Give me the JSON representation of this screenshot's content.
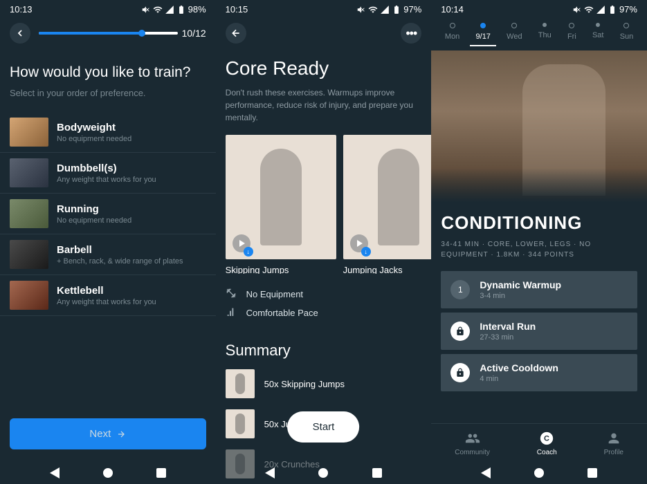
{
  "screen1": {
    "time": "10:13",
    "battery": "98%",
    "progress": "10/12",
    "question": "How would you like to train?",
    "subtitle": "Select in your order of preference.",
    "options": [
      {
        "name": "Bodyweight",
        "desc": "No equipment needed"
      },
      {
        "name": "Dumbbell(s)",
        "desc": "Any weight that works for you"
      },
      {
        "name": "Running",
        "desc": "No equipment needed"
      },
      {
        "name": "Barbell",
        "desc": "+ Bench, rack, & wide range of plates"
      },
      {
        "name": "Kettlebell",
        "desc": "Any weight that works for you"
      }
    ],
    "next": "Next"
  },
  "screen2": {
    "time": "10:15",
    "battery": "97%",
    "title": "Core Ready",
    "description": "Don't rush these exercises. Warmups improve performance, reduce risk of injury, and prepare you mentally.",
    "exercises": [
      {
        "label": "Skipping Jumps"
      },
      {
        "label": "Jumping Jacks"
      }
    ],
    "meta": {
      "equipment": "No Equipment",
      "pace": "Comfortable Pace"
    },
    "summary_title": "Summary",
    "summary": [
      {
        "text": "50x Skipping Jumps"
      },
      {
        "text": "50x Ju"
      },
      {
        "text": "20x Crunches"
      }
    ],
    "start": "Start"
  },
  "screen3": {
    "time": "10:14",
    "battery": "97%",
    "days": [
      {
        "label": "Mon",
        "active": false,
        "filled": false
      },
      {
        "label": "9/17",
        "active": true,
        "filled": true
      },
      {
        "label": "Wed",
        "active": false,
        "filled": false
      },
      {
        "label": "Thu",
        "active": false,
        "filled": false
      },
      {
        "label": "Fri",
        "active": false,
        "filled": false
      },
      {
        "label": "Sat",
        "active": false,
        "filled": false
      },
      {
        "label": "Sun",
        "active": false,
        "filled": false
      }
    ],
    "workout_title": "CONDITIONING",
    "workout_meta": "34-41 MIN · CORE, LOWER, LEGS · NO EQUIPMENT · 1.8KM · 344 POINTS",
    "segments": [
      {
        "badge": "1",
        "locked": false,
        "name": "Dynamic Warmup",
        "duration": "3-4 min"
      },
      {
        "badge": "lock",
        "locked": true,
        "name": "Interval Run",
        "duration": "27-33 min"
      },
      {
        "badge": "lock",
        "locked": true,
        "name": "Active Cooldown",
        "duration": "4 min"
      }
    ],
    "tabs": [
      {
        "label": "Community",
        "active": false
      },
      {
        "label": "Coach",
        "active": true
      },
      {
        "label": "Profile",
        "active": false
      }
    ]
  }
}
